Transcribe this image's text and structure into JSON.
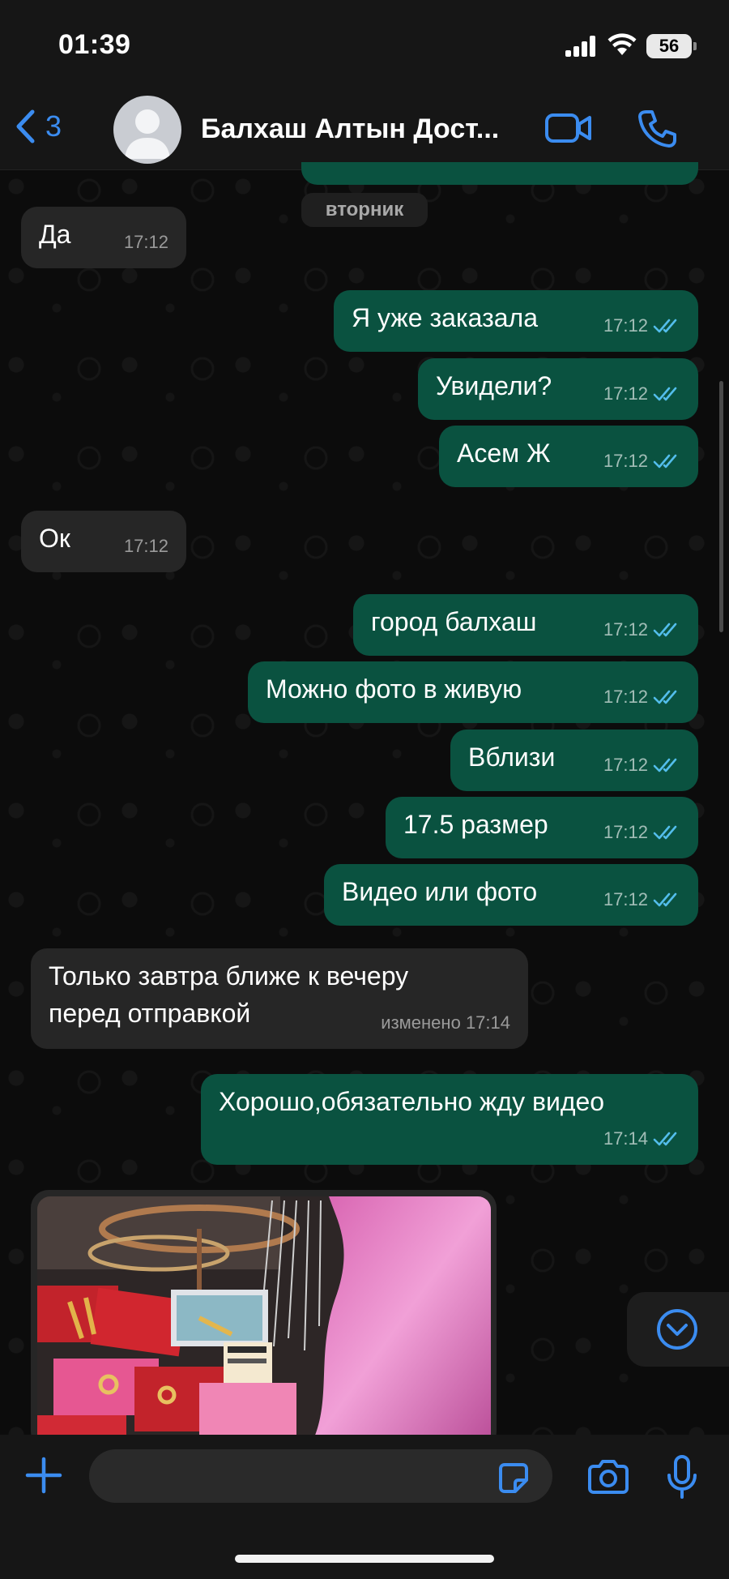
{
  "status_bar": {
    "time": "01:39",
    "battery": "56"
  },
  "header": {
    "back_count": "3",
    "contact_name": "Балхаш Алтын Дост...",
    "icons": {
      "back": "chevron-left-icon",
      "video": "video-camera-icon",
      "call": "phone-icon"
    }
  },
  "day_chip": "вторник",
  "messages": [
    {
      "direction": "in",
      "text": "Да",
      "time": "17:12"
    },
    {
      "direction": "out",
      "text": "Я уже заказала",
      "time": "17:12",
      "read": true
    },
    {
      "direction": "out",
      "text": "Увидели?",
      "time": "17:12",
      "read": true
    },
    {
      "direction": "out",
      "text": "Асем Ж",
      "time": "17:12",
      "read": true
    },
    {
      "direction": "in",
      "text": "Ок",
      "time": "17:12"
    },
    {
      "direction": "out",
      "text": "город балхаш",
      "time": "17:12",
      "read": true
    },
    {
      "direction": "out",
      "text": "Можно фото в живую",
      "time": "17:12",
      "read": true
    },
    {
      "direction": "out",
      "text": "Вблизи",
      "time": "17:12",
      "read": true
    },
    {
      "direction": "out",
      "text": "17.5 размер",
      "time": "17:12",
      "read": true
    },
    {
      "direction": "out",
      "text": "Видео или фото",
      "time": "17:12",
      "read": true
    },
    {
      "direction": "in",
      "text_line1": "Только завтра ближе к вечеру",
      "text_line2": "перед отправкой",
      "edited_label": "изменено",
      "time": "17:14"
    },
    {
      "direction": "out",
      "text": "Хорошо,обязательно жду видео",
      "time": "17:14",
      "read": true
    }
  ],
  "photo_message": {
    "description_icon": "photo-jewelry-display"
  },
  "composer": {
    "placeholder": "",
    "icons": {
      "plus": "plus-icon",
      "sticker": "sticker-icon",
      "camera": "camera-icon",
      "mic": "microphone-icon"
    }
  },
  "colors": {
    "accent": "#3b8cf0",
    "outgoing_bubble": "#0a5240",
    "incoming_bubble": "#262626",
    "read_ticks": "#53bdeb"
  }
}
